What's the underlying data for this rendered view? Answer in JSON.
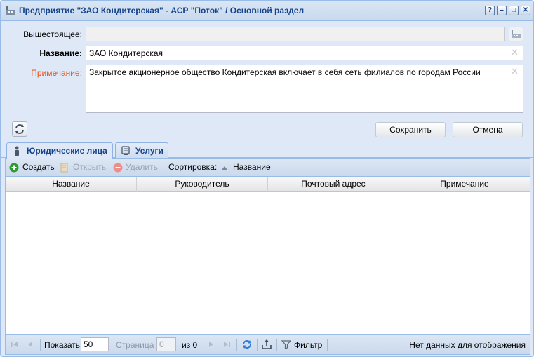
{
  "window": {
    "title": "Предприятие \"ЗАО Кондитерская\" - АСР \"Поток\" / Основной раздел",
    "buttons": [
      "?",
      "–",
      "□",
      "✕"
    ]
  },
  "form": {
    "parent_label": "Вышестоящее:",
    "parent_value": "",
    "name_label": "Название:",
    "name_value": "ЗАО Кондитерская",
    "note_label": "Примечание:",
    "note_value": "Закрытое акционерное общество Кондитерская включает в себя сеть филиалов по городам России"
  },
  "actions": {
    "save": "Сохранить",
    "cancel": "Отмена"
  },
  "tabs": [
    {
      "label": "Юридические лица",
      "active": true,
      "icon": "person-icon"
    },
    {
      "label": "Услуги",
      "active": false,
      "icon": "services-icon"
    }
  ],
  "toolbar": {
    "create": "Создать",
    "open": "Открыть",
    "delete": "Удалить",
    "sort_label": "Сортировка:",
    "sort_field": "Название"
  },
  "grid": {
    "columns": [
      "Название",
      "Руководитель",
      "Почтовый адрес",
      "Примечание"
    ],
    "rows": []
  },
  "pager": {
    "show_label": "Показать",
    "page_size": "50",
    "page_label": "Страница",
    "page_value": "0",
    "of_label": "из 0",
    "filter": "Фильтр",
    "status": "Нет данных для отображения"
  },
  "colors": {
    "title": "#15428b",
    "accent_orange": "#e8521a",
    "create_green": "#2e9a2e",
    "delete_red": "#e0504a",
    "frame": "#99bbe8"
  }
}
